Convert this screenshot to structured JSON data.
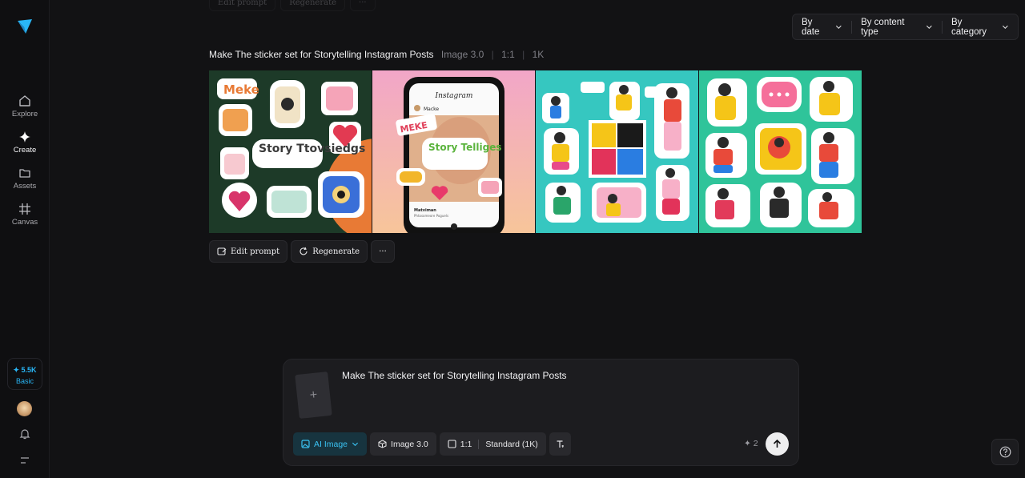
{
  "sidebar": {
    "logo_icon": "arrow-plane-logo",
    "items": [
      {
        "label": "Explore",
        "icon": "home-icon"
      },
      {
        "label": "Create",
        "icon": "sparkle-icon"
      },
      {
        "label": "Assets",
        "icon": "folder-icon"
      },
      {
        "label": "Canvas",
        "icon": "grid-icon"
      }
    ],
    "credits": {
      "amount": "✦ 5.5K",
      "plan": "Basic"
    }
  },
  "top_strip": {
    "edit_label": "Edit prompt",
    "regen_label": "Regenerate"
  },
  "filters": {
    "by_date": "By date",
    "by_content_type": "By content type",
    "by_category": "By category"
  },
  "generation": {
    "prompt": "Make The sticker set for Storytelling Instagram Posts",
    "model": "Image 3.0",
    "ratio": "1:1",
    "resolution": "1K",
    "images": [
      {
        "caption": "Meke",
        "title": "Story Ttovsiedgs"
      },
      {
        "header": "Instagram",
        "user": "Macke",
        "sticker": "MEKE",
        "title": "Story Telliges",
        "footer_name": "Matviman",
        "footer_sub": "Phtosomeore Poguels"
      },
      {
        "caption": ""
      },
      {
        "caption": ""
      }
    ]
  },
  "actions": {
    "edit": "Edit prompt",
    "regenerate": "Regenerate",
    "more": "···"
  },
  "composer": {
    "text": "Make The sticker set for Storytelling Instagram Posts",
    "upload": "+",
    "mode": "AI Image",
    "model": "Image 3.0",
    "ratio": "1:1",
    "quality": "Standard (1K)",
    "cost": "✦ 2"
  },
  "colors": {
    "accent": "#29b6f6",
    "background": "#121214",
    "panel": "#1c1c1f"
  }
}
